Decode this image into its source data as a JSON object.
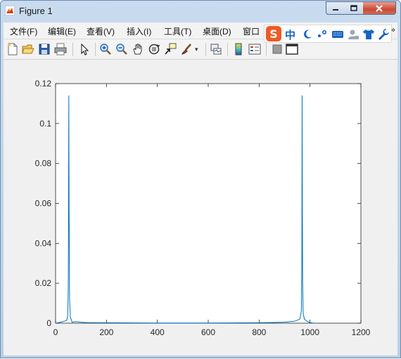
{
  "window": {
    "title": "Figure 1"
  },
  "menu": {
    "items": [
      {
        "label": "文件(F)"
      },
      {
        "label": "编辑(E)"
      },
      {
        "label": "查看(V)"
      },
      {
        "label": "插入(I)"
      },
      {
        "label": "工具(T)"
      },
      {
        "label": "桌面(D)"
      },
      {
        "label": "窗口"
      }
    ]
  },
  "ime": {
    "logo": "S",
    "mode": "中"
  },
  "toolbar": {
    "icons": [
      "new-figure-icon",
      "open-file-icon",
      "save-icon",
      "print-icon",
      "pointer-icon",
      "zoom-in-icon",
      "zoom-out-icon",
      "pan-hand-icon",
      "rotate-3d-icon",
      "data-cursor-icon",
      "brush-icon",
      "link-plot-icon",
      "colorbar-icon",
      "legend-icon",
      "hide-tools-icon",
      "dock-icon"
    ]
  },
  "colors": {
    "line": "#0072bd",
    "plot_bg": "#ffffff",
    "figure_bg": "#f0f0f0"
  },
  "chart_data": {
    "type": "line",
    "title": "",
    "xlabel": "",
    "ylabel": "",
    "xlim": [
      0,
      1200
    ],
    "ylim": [
      0,
      0.12
    ],
    "xticks": [
      0,
      200,
      400,
      600,
      800,
      1000,
      1200
    ],
    "xtick_labels": [
      "0",
      "200",
      "400",
      "600",
      "800",
      "1000",
      "1200"
    ],
    "yticks": [
      0,
      0.02,
      0.04,
      0.06,
      0.08,
      0.1,
      0.12
    ],
    "ytick_labels": [
      "0",
      "0.02",
      "0.04",
      "0.06",
      "0.08",
      "0.1",
      "0.12"
    ],
    "grid": false,
    "series": [
      {
        "color": "#0072bd",
        "x": [
          0,
          20,
          35,
          44,
          48,
          50,
          51,
          52,
          53,
          55,
          58,
          65,
          80,
          100,
          120,
          200,
          400,
          600,
          800,
          900,
          940,
          960,
          966,
          968,
          969,
          970,
          971,
          973,
          978,
          990,
          1000,
          1010,
          1024
        ],
        "y": [
          0,
          0.0005,
          0.001,
          0.0015,
          0.004,
          0.02,
          0.06,
          0.114,
          0.06,
          0.012,
          0.003,
          0.0005,
          0.0008,
          0.0005,
          0.0003,
          0.0002,
          0.0001,
          0.0001,
          0.0002,
          0.0005,
          0.001,
          0.002,
          0.006,
          0.03,
          0.114,
          0.06,
          0.02,
          0.005,
          0.002,
          0.0008,
          0.0003,
          0.0001,
          0
        ]
      }
    ]
  }
}
